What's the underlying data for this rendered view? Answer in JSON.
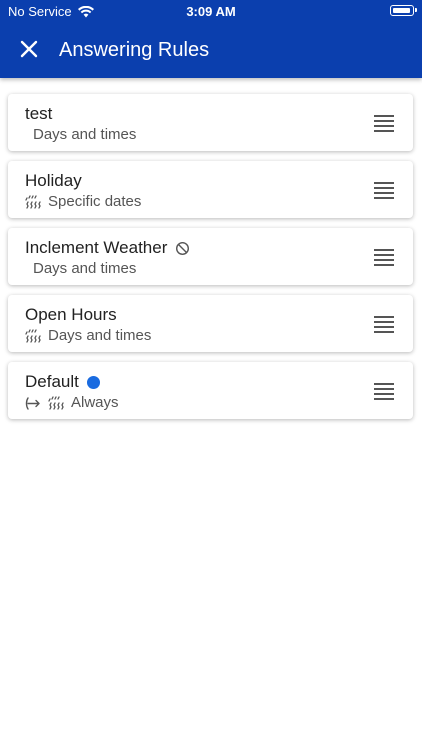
{
  "status_bar": {
    "carrier": "No Service",
    "time": "3:09 AM",
    "wifi_icon": "wifi-icon",
    "battery_icon": "battery-icon"
  },
  "header": {
    "title": "Answering Rules",
    "close_icon": "close-icon",
    "background": "#0b3fae"
  },
  "rules": [
    {
      "title": "test",
      "subtitle": "Days and times",
      "icons": []
    },
    {
      "title": "Holiday",
      "subtitle": "Specific dates",
      "icons": [
        "calendar-icon"
      ]
    },
    {
      "title": "Inclement Weather",
      "subtitle": "Days and times",
      "icons": [],
      "title_icon": "disabled-icon"
    },
    {
      "title": "Open Hours",
      "subtitle": "Days and times",
      "icons": [
        "calendar-icon"
      ]
    },
    {
      "title": "Default",
      "subtitle": "Always",
      "icons": [
        "forward-call-icon",
        "calendar-icon"
      ],
      "title_badge_color": "#1a6be0"
    }
  ]
}
